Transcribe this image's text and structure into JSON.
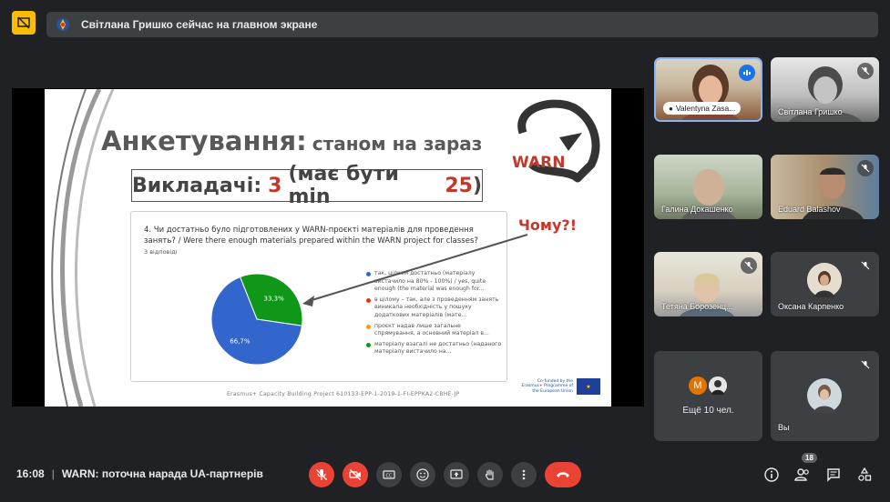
{
  "banner": {
    "text": "Світлана Гришко сейчас на главном экране"
  },
  "slide": {
    "title": "Анкетування:",
    "subtitle": "станом на зараз",
    "teachers_label": "Викладачі:",
    "teachers_current": "3",
    "teachers_must_prefix": "(має бути min",
    "teachers_min": "25",
    "teachers_suffix": ")",
    "logo_text": "WARN",
    "chomu": "Чому?!",
    "question": "4. Чи достатньо було підготовлених у WARN-проєкті матеріалів для проведення занять? / Were there enough materials prepared within the WARN project for classes?",
    "responses": "3 відповіді",
    "footer": "Erasmus+ Capacity Building Project  610133-EPP-1-2019-1-FI-EPPKA2-CBHE-JP",
    "eu_text": "Co-funded by the Erasmus+ Programme of the European Union"
  },
  "chart_data": {
    "type": "pie",
    "values": [
      66.7,
      33.3
    ],
    "labels": [
      "66,7%",
      "33,3%"
    ],
    "colors": [
      "#3366cc",
      "#109618"
    ],
    "legend": [
      {
        "text": "так, цілком достатньо (матеріалу вистачило на 80% - 100%) / yes, quite enough (the material was enough for...",
        "color": "#3366cc"
      },
      {
        "text": "в цілому – так, але з проведенням занять виникала необхідність у пошуку додаткових матеріалів (мате...",
        "color": "#dc3912"
      },
      {
        "text": "проєкт надав лише загальне спрямування, а основний матеріал в...",
        "color": "#ff9900"
      },
      {
        "text": "матеріалу взагалі не достатньо (наданого матеріалу вистачило на...",
        "color": "#109618"
      }
    ]
  },
  "participants": [
    {
      "name": "Valentyna Zasa...",
      "speaking": true
    },
    {
      "name": "Світлана Гришко",
      "muted": true
    },
    {
      "name": "Галина Докашенко",
      "muted": false
    },
    {
      "name": "Eduard Balashov",
      "muted": true
    },
    {
      "name": "Тетяна Борозенц...",
      "muted": true
    },
    {
      "name": "Оксана Карпенко",
      "muted": true
    },
    {
      "name": "Ещё 10 чел.",
      "initial": "M"
    },
    {
      "name": "Вы",
      "muted": true
    }
  ],
  "meeting": {
    "time": "16:08",
    "separator": "|",
    "title": "WARN: поточна нарада UA-партнерів"
  },
  "people_count": "18",
  "colors": {
    "background": "#202124",
    "tile": "#3c4043",
    "danger": "#ea4335",
    "accent": "#fbbc04"
  }
}
